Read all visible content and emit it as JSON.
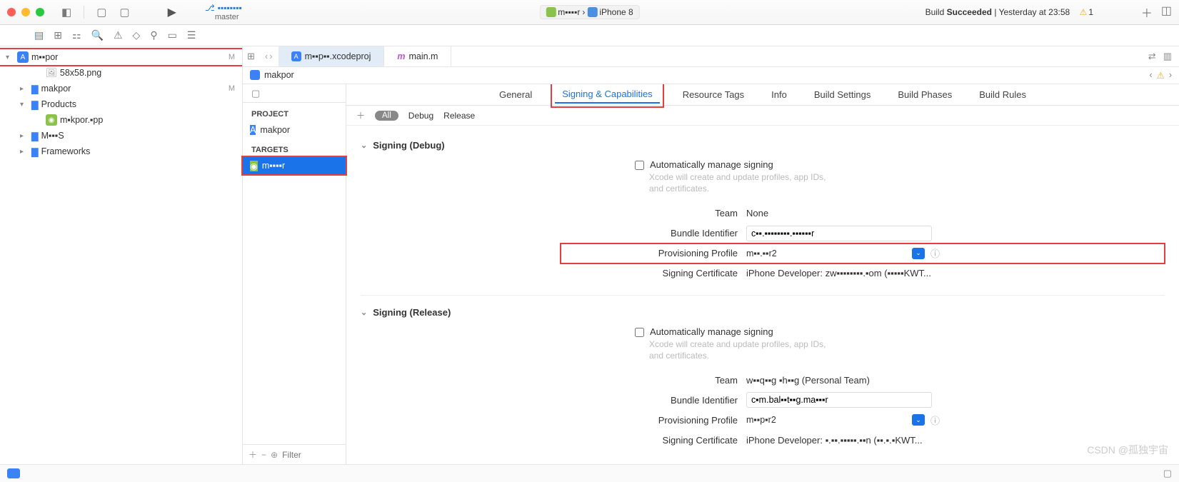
{
  "titlebar": {
    "branch_name": "▪▪▪▪▪▪▪▪",
    "branch_sub": "master",
    "seg_left": "m▪▪▪▪r",
    "seg_right": "iPhone 8",
    "build_prefix": "Build",
    "build_status": "Succeeded",
    "build_time": "Yesterday at 23:58",
    "warn_count": "1"
  },
  "nav": {
    "items": [
      {
        "label": "m▪▪por",
        "icon": "proj",
        "mod": "M",
        "disc": "▾",
        "ind": 0,
        "red": true
      },
      {
        "label": "58x58.png",
        "icon": "img",
        "disc": "",
        "ind": 2
      },
      {
        "label": "makpor",
        "icon": "folder",
        "mod": "M",
        "disc": "▸",
        "ind": 1
      },
      {
        "label": "Products",
        "icon": "folder",
        "disc": "▾",
        "ind": 1
      },
      {
        "label": "m▪kpor.▪pp",
        "icon": "app",
        "disc": "",
        "ind": 2
      },
      {
        "label": "M▪▪▪S",
        "icon": "folder",
        "disc": "▸",
        "ind": 1
      },
      {
        "label": "Frameworks",
        "icon": "folder",
        "disc": "▸",
        "ind": 1
      }
    ]
  },
  "tabs": {
    "t0": "m▪▪p▪▪.xcodeproj",
    "t1": "main.m"
  },
  "crumb": "makpor",
  "targets": {
    "section_project": "PROJECT",
    "project_item": "makpor",
    "section_targets": "TARGETS",
    "target_item": "m▪▪▪▪r",
    "filter_placeholder": "Filter"
  },
  "main_tabs": {
    "general": "General",
    "signing": "Signing & Capabilities",
    "resource": "Resource Tags",
    "info": "Info",
    "build_settings": "Build Settings",
    "build_phases": "Build Phases",
    "build_rules": "Build Rules"
  },
  "config_bar": {
    "all": "All",
    "debug": "Debug",
    "release": "Release"
  },
  "signing": {
    "section_debug": "Signing (Debug)",
    "section_release": "Signing (Release)",
    "auto_label": "Automatically manage signing",
    "auto_hint": "Xcode will create and update profiles, app IDs, and certificates.",
    "team_label": "Team",
    "team_value_debug": "None",
    "team_value_release": "w▪▪q▪▪g ▪h▪▪g (Personal Team)",
    "bundle_label": "Bundle Identifier",
    "bundle_value": "c▪▪.▪▪▪▪▪▪▪▪.▪▪▪▪▪▪r",
    "bundle_value_rel": "c▪m.bal▪▪t▪▪g.ma▪▪▪r",
    "profile_label": "Provisioning Profile",
    "profile_value": "m▪▪.▪▪r2",
    "profile_value_rel": "m▪▪p▪r2",
    "cert_label": "Signing Certificate",
    "cert_value": "iPhone Developer: zw▪▪▪▪▪▪▪▪.▪om (▪▪▪▪▪KWT...",
    "cert_value_rel": "iPhone Developer: ▪.▪▪.▪▪▪▪▪.▪▪n (▪▪.▪.▪KWT..."
  },
  "watermark": "CSDN @孤独宇宙"
}
